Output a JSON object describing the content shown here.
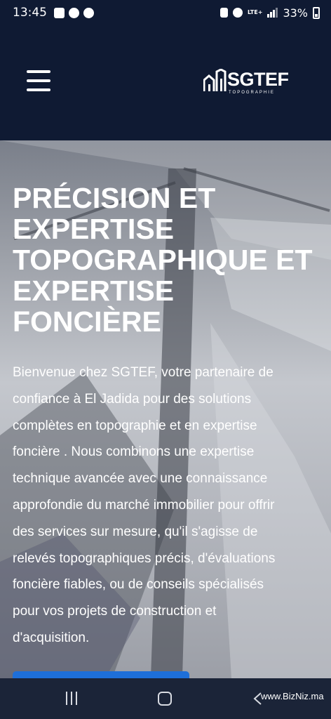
{
  "status_bar": {
    "time": "13:45",
    "network": "LTE+",
    "battery": "33%",
    "icons": [
      "gallery-icon",
      "phone-icon",
      "message-icon",
      "nfc-icon",
      "hotspot-icon",
      "signal-icon",
      "battery-icon"
    ]
  },
  "header": {
    "logo_text": "SGTEF",
    "logo_subtitle": "TOPOGRAPHIE",
    "menu_icon": "hamburger-icon"
  },
  "hero": {
    "title": "PRÉCISION ET EXPERTISE TOPOGRAPHIQUE ET EXPERTISE FONCIÈRE",
    "description": "Bienvenue chez SGTEF, votre partenaire de confiance à El Jadida pour des solutions complètes en topographie et en expertise foncière . Nous combinons une expertise technique avancée avec une connaissance approfondie du marché immobilier pour offrir des services sur mesure, qu'il s'agisse de relevés topographiques précis, d'évaluations foncière fiables, ou de conseils spécialisés pour vos projets de construction et d'acquisition."
  },
  "system_nav": {
    "watermark": "www.BizNiz.ma",
    "icons": [
      "recents-icon",
      "home-icon",
      "back-icon"
    ]
  },
  "colors": {
    "navy": "#0f1a33",
    "cta_blue": "#1e6fd9",
    "nav_bar": "#1b2438"
  }
}
